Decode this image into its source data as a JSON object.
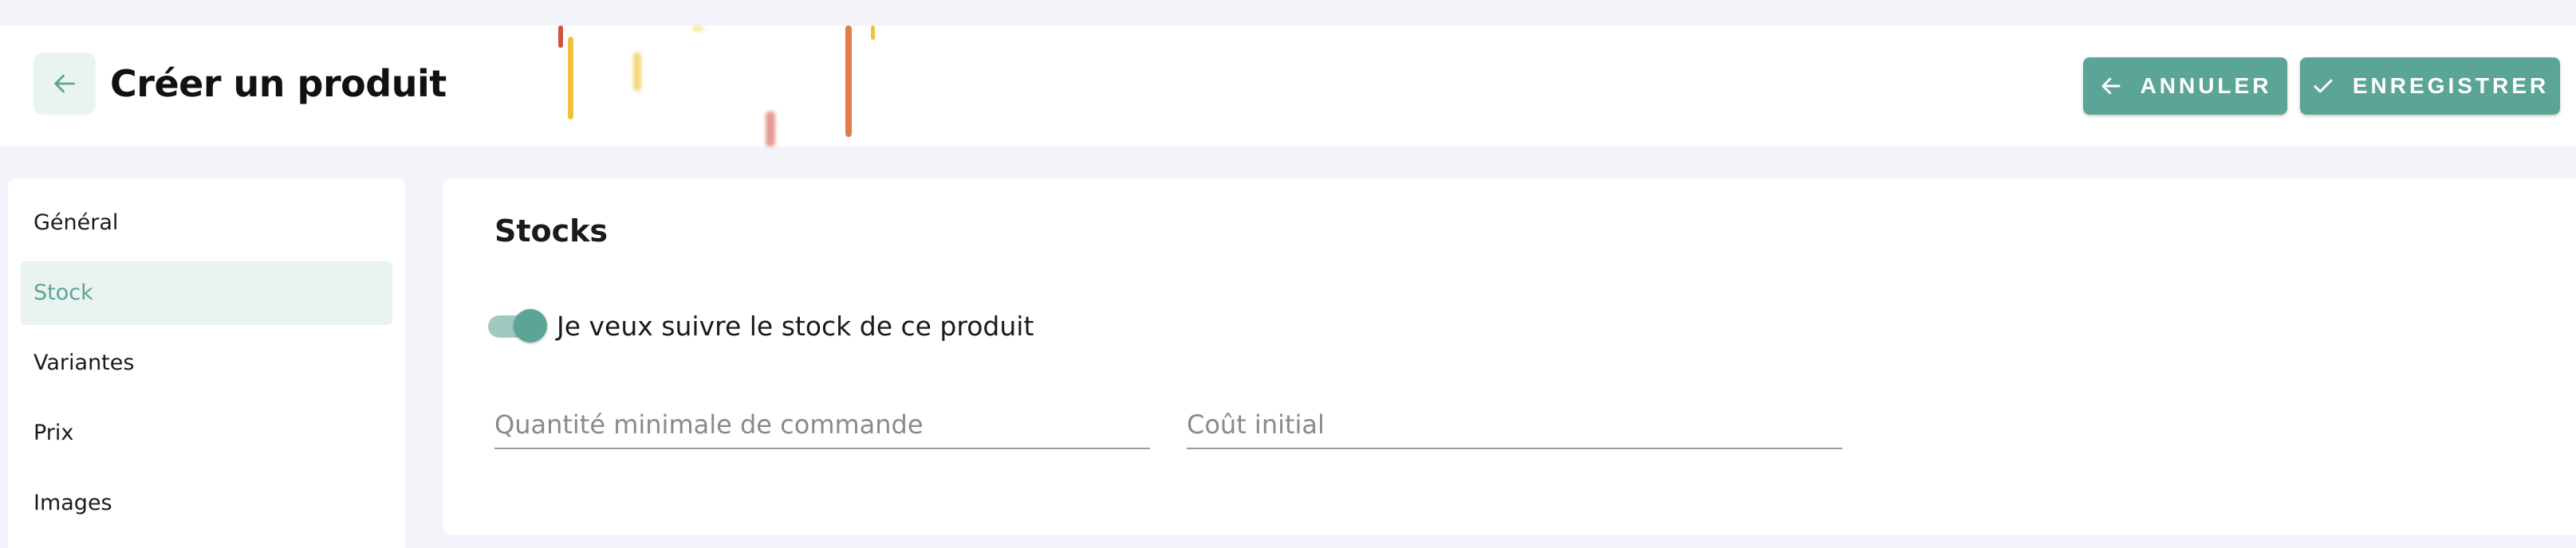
{
  "header": {
    "title": "Créer un produit",
    "back_icon": "arrow-left-icon",
    "cancel_label": "ANNULER",
    "cancel_icon": "arrow-left-icon",
    "save_label": "ENREGISTRER",
    "save_icon": "check-icon"
  },
  "sidebar": {
    "items": [
      {
        "label": "Général",
        "active": false
      },
      {
        "label": "Stock",
        "active": true
      },
      {
        "label": "Variantes",
        "active": false
      },
      {
        "label": "Prix",
        "active": false
      },
      {
        "label": "Images",
        "active": false
      }
    ]
  },
  "stock": {
    "title": "Stocks",
    "track_toggle_label": "Je veux suivre le stock de ce produit",
    "track_toggle_on": true,
    "min_quantity_placeholder": "Quantité minimale de commande",
    "initial_cost_placeholder": "Coût initial"
  },
  "colors": {
    "accent": "#5ba596",
    "accent_light": "#e9f3f0",
    "background": "#f3f4f9"
  }
}
